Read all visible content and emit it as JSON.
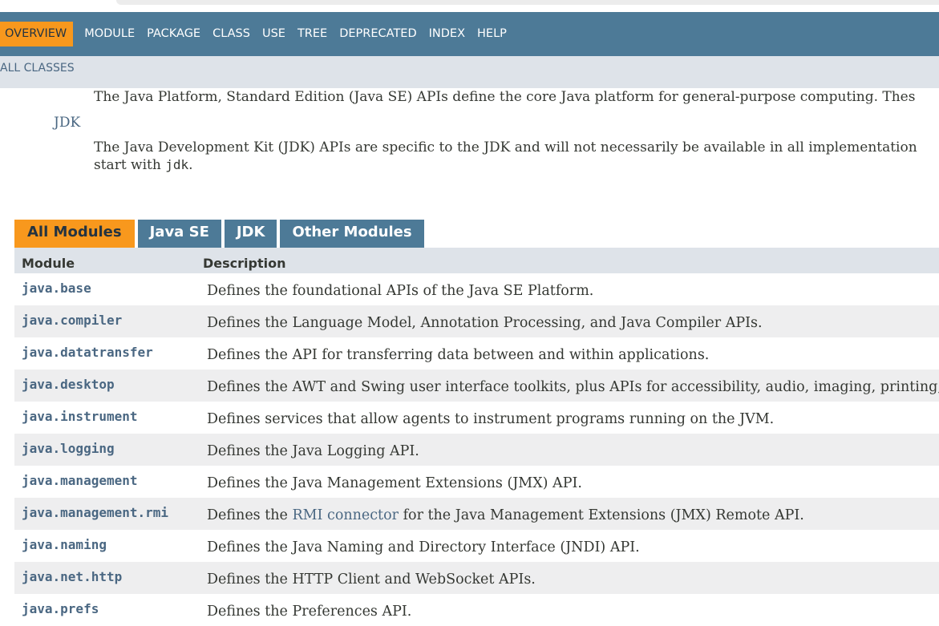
{
  "nav": {
    "items": [
      "OVERVIEW",
      "MODULE",
      "PACKAGE",
      "CLASS",
      "USE",
      "TREE",
      "DEPRECATED",
      "INDEX",
      "HELP"
    ]
  },
  "subnav": {
    "all_classes": "ALL CLASSES"
  },
  "groups": {
    "javase_desc": "The Java Platform, Standard Edition (Java SE) APIs define the core Java platform for general-purpose computing. Thes",
    "jdk_link": "JDK",
    "jdk_desc_line1": "The Java Development Kit (JDK) APIs are specific to the JDK and will not necessarily be available in all implementation",
    "jdk_desc_line2_prefix": "start with ",
    "jdk_desc_code": "jdk",
    "jdk_desc_line2_suffix": "."
  },
  "tabs": [
    "All Modules",
    "Java SE",
    "JDK",
    "Other Modules"
  ],
  "table": {
    "headers": {
      "module": "Module",
      "description": "Description"
    },
    "rows": [
      {
        "module": "java.base",
        "desc": "Defines the foundational APIs of the Java SE Platform."
      },
      {
        "module": "java.compiler",
        "desc": "Defines the Language Model, Annotation Processing, and Java Compiler APIs."
      },
      {
        "module": "java.datatransfer",
        "desc": "Defines the API for transferring data between and within applications."
      },
      {
        "module": "java.desktop",
        "desc": "Defines the AWT and Swing user interface toolkits, plus APIs for accessibility, audio, imaging, printing,"
      },
      {
        "module": "java.instrument",
        "desc": "Defines services that allow agents to instrument programs running on the JVM."
      },
      {
        "module": "java.logging",
        "desc": "Defines the Java Logging API."
      },
      {
        "module": "java.management",
        "desc": "Defines the Java Management Extensions (JMX) API."
      },
      {
        "module": "java.management.rmi",
        "desc_prefix": "Defines the ",
        "desc_link": "RMI connector",
        "desc_suffix": " for the Java Management Extensions (JMX) Remote API."
      },
      {
        "module": "java.naming",
        "desc": "Defines the Java Naming and Directory Interface (JNDI) API."
      },
      {
        "module": "java.net.http",
        "desc": "Defines the HTTP Client and WebSocket APIs."
      },
      {
        "module": "java.prefs",
        "desc": "Defines the Preferences API."
      }
    ]
  }
}
